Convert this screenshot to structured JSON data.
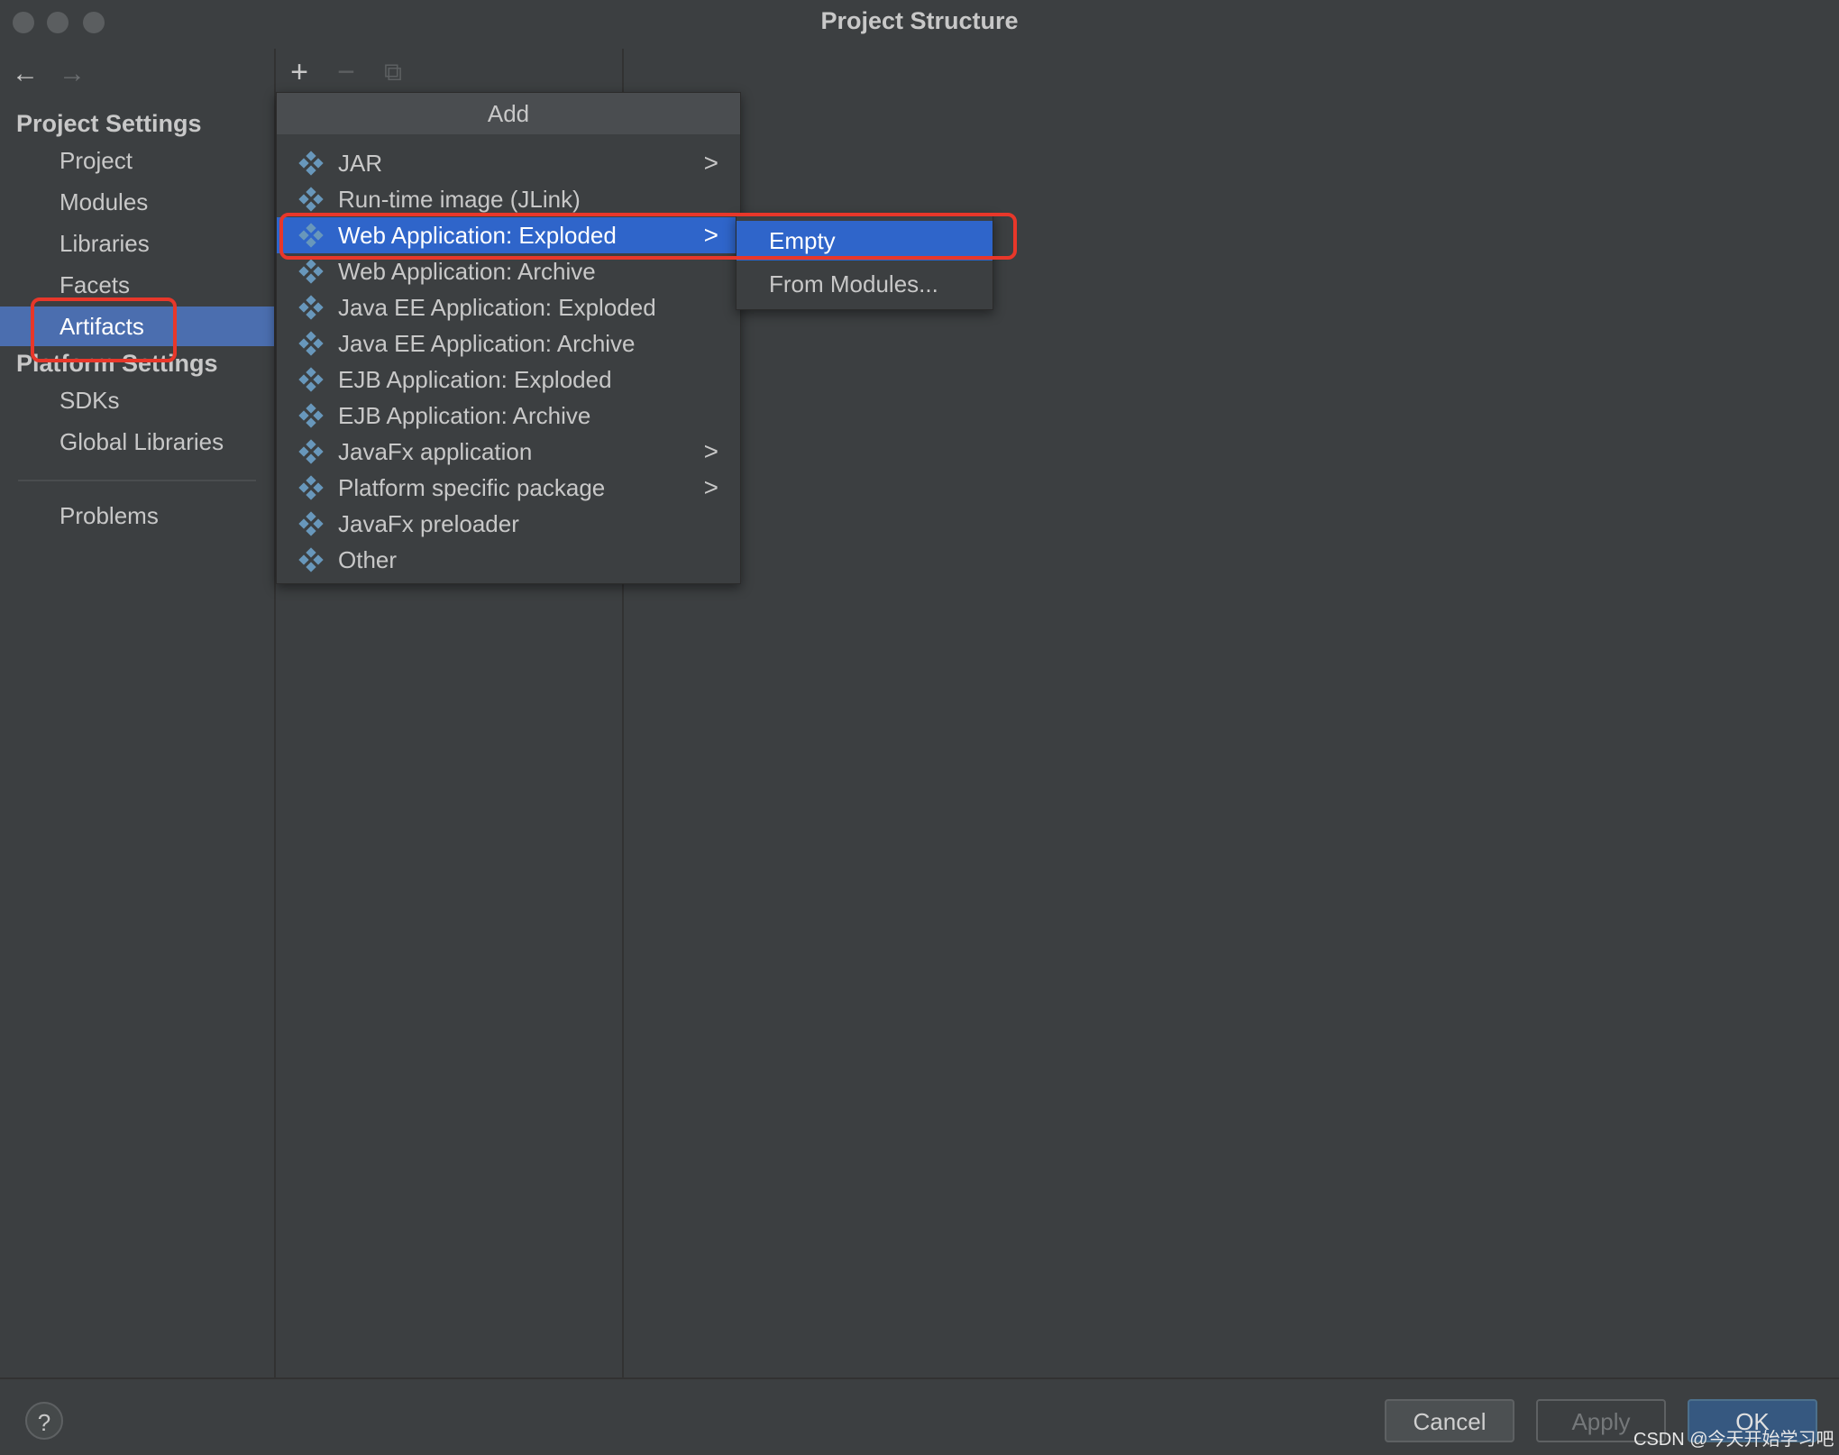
{
  "window": {
    "title": "Project Structure"
  },
  "nav": {
    "back": "←",
    "forward": "→"
  },
  "sidebar": {
    "project_settings_title": "Project Settings",
    "project_items": [
      "Project",
      "Modules",
      "Libraries",
      "Facets",
      "Artifacts"
    ],
    "selected": "Artifacts",
    "platform_settings_title": "Platform Settings",
    "platform_items": [
      "SDKs",
      "Global Libraries"
    ],
    "problems": "Problems"
  },
  "toolbar": {
    "add": "+",
    "remove": "−",
    "copy": "⧉"
  },
  "popup": {
    "title": "Add",
    "items": [
      {
        "label": "JAR",
        "submenu": true
      },
      {
        "label": "Run-time image (JLink)",
        "submenu": false
      },
      {
        "label": "Web Application: Exploded",
        "submenu": true
      },
      {
        "label": "Web Application: Archive",
        "submenu": false
      },
      {
        "label": "Java EE Application: Exploded",
        "submenu": false
      },
      {
        "label": "Java EE Application: Archive",
        "submenu": false
      },
      {
        "label": "EJB Application: Exploded",
        "submenu": false
      },
      {
        "label": "EJB Application: Archive",
        "submenu": false
      },
      {
        "label": "JavaFx application",
        "submenu": true
      },
      {
        "label": "Platform specific package",
        "submenu": true
      },
      {
        "label": "JavaFx preloader",
        "submenu": false
      },
      {
        "label": "Other",
        "submenu": false
      }
    ],
    "chevron": ">"
  },
  "submenu": {
    "items": [
      "Empty",
      "From Modules..."
    ]
  },
  "buttons": {
    "help": "?",
    "cancel": "Cancel",
    "apply": "Apply",
    "ok": "OK"
  },
  "watermark": "CSDN @今天开始学习吧",
  "colors": {
    "selection": "#4b6eaf",
    "menu_active": "#2f65ca",
    "annotation": "#e8372a",
    "icon_blue": "#6897bb"
  }
}
